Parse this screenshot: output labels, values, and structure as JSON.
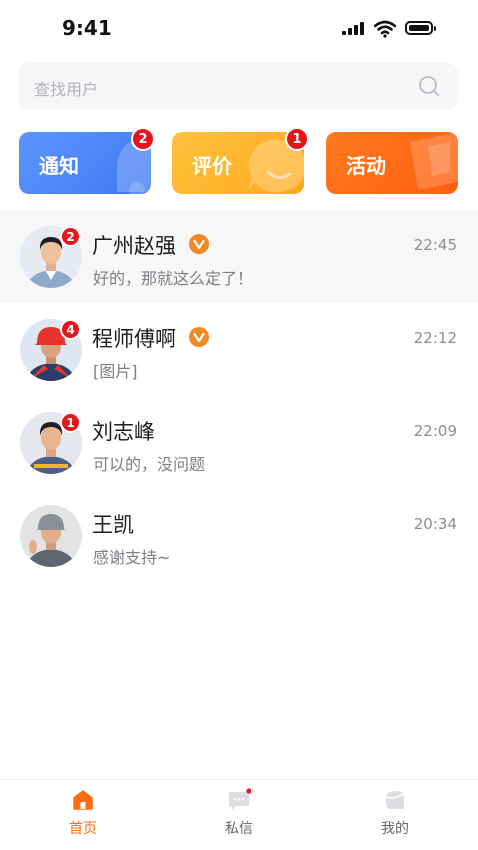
{
  "status_bar": {
    "time": "9:41"
  },
  "search": {
    "placeholder": "查找用户"
  },
  "categories": [
    {
      "label": "通知",
      "badge": "2",
      "color": "#4a86f8"
    },
    {
      "label": "评价",
      "badge": "1",
      "color": "#ffb22a"
    },
    {
      "label": "活动",
      "badge": "",
      "color": "#ff6a14"
    }
  ],
  "conversations": [
    {
      "name": "广州赵强",
      "verified": true,
      "message": "好的，那就这么定了！",
      "time": "22:45",
      "unread": "2"
    },
    {
      "name": "程师傅啊",
      "verified": true,
      "message": "[图片]",
      "time": "22:12",
      "unread": "4"
    },
    {
      "name": "刘志峰",
      "verified": false,
      "message": "可以的，没问题",
      "time": "22:09",
      "unread": "1"
    },
    {
      "name": "王凯",
      "verified": false,
      "message": "感谢支持~",
      "time": "20:34",
      "unread": ""
    }
  ],
  "tabs": [
    {
      "label": "首页",
      "active": true,
      "icon": "home-icon"
    },
    {
      "label": "私信",
      "active": false,
      "icon": "message-icon"
    },
    {
      "label": "我的",
      "active": false,
      "icon": "profile-icon"
    }
  ],
  "colors": {
    "accent": "#ff6d10",
    "badge": "#e8141b",
    "verified": "#f08a24"
  }
}
